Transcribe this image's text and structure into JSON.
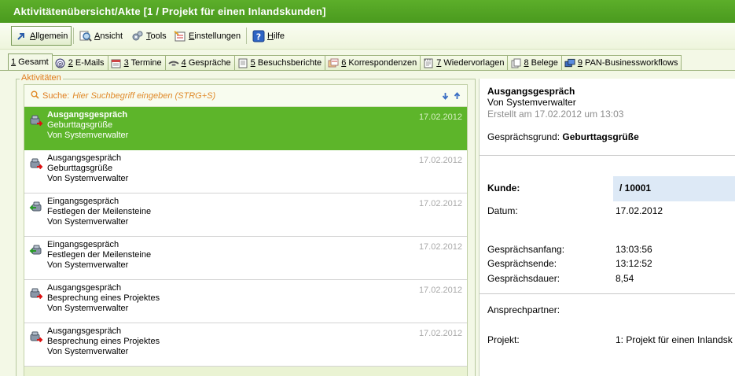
{
  "window": {
    "title": "Aktivitätenübersicht/Akte [1 / Projekt für einen Inlandskunden]"
  },
  "toolbar": {
    "allgemein": {
      "pre": "",
      "u": "A",
      "post": "llgemein"
    },
    "ansicht": {
      "pre": "",
      "u": "A",
      "post": "nsicht"
    },
    "tools": {
      "pre": "",
      "u": "T",
      "post": "ools"
    },
    "einstellungen": {
      "pre": "",
      "u": "E",
      "post": "instellungen"
    },
    "hilfe": {
      "pre": "",
      "u": "H",
      "post": "ilfe"
    }
  },
  "tabs": [
    {
      "num": "1",
      "label": " Gesamt",
      "icon": ""
    },
    {
      "num": "2",
      "label": " E-Mails",
      "icon": "at-icon"
    },
    {
      "num": "3",
      "label": " Termine",
      "icon": "calendar-icon"
    },
    {
      "num": "4",
      "label": " Gespräche",
      "icon": "phone-icon"
    },
    {
      "num": "5",
      "label": " Besuchsberichte",
      "icon": "report-icon"
    },
    {
      "num": "6",
      "label": " Korrespondenzen",
      "icon": "letters-icon"
    },
    {
      "num": "7",
      "label": " Wiedervorlagen",
      "icon": "notepad-icon"
    },
    {
      "num": "8",
      "label": " Belege",
      "icon": "documents-icon"
    },
    {
      "num": "9",
      "label": " PAN-Businessworkflows",
      "icon": "workflow-icon"
    }
  ],
  "group": {
    "legend": "Aktivitäten"
  },
  "search": {
    "label": "Suche:",
    "placeholder": "Hier Suchbegriff eingeben (STRG+S)"
  },
  "activities": [
    {
      "type": "Ausgangsgespräch",
      "subject": "Geburttagsgrüße",
      "author": "Von Systemverwalter",
      "date": "17.02.2012",
      "direction": "outgoing"
    },
    {
      "type": "Ausgangsgespräch",
      "subject": "Geburttagsgrüße",
      "author": "Von Systemverwalter",
      "date": "17.02.2012",
      "direction": "outgoing"
    },
    {
      "type": "Eingangsgespräch",
      "subject": "Festlegen der Meilensteine",
      "author": "Von Systemverwalter",
      "date": "17.02.2012",
      "direction": "incoming"
    },
    {
      "type": "Eingangsgespräch",
      "subject": "Festlegen der Meilensteine",
      "author": "Von Systemverwalter",
      "date": "17.02.2012",
      "direction": "incoming"
    },
    {
      "type": "Ausgangsgespräch",
      "subject": "Besprechung eines Projektes",
      "author": "Von Systemverwalter",
      "date": "17.02.2012",
      "direction": "outgoing"
    },
    {
      "type": "Ausgangsgespräch",
      "subject": "Besprechung eines Projektes",
      "author": "Von Systemverwalter",
      "date": "17.02.2012",
      "direction": "outgoing"
    }
  ],
  "detail": {
    "title": "Ausgangsgespräch",
    "by": "Von Systemverwalter",
    "created": "Erstellt am 17.02.2012 um 13:03",
    "reason_label": "Gesprächsgrund:",
    "reason_value": "Geburttagsgrüße",
    "kunde_label": "Kunde:",
    "kunde_value": "/ 10001",
    "datum_label": "Datum:",
    "datum_value": "17.02.2012",
    "anfang_label": "Gesprächsanfang:",
    "anfang_value": "13:03:56",
    "ende_label": "Gesprächsende:",
    "ende_value": "13:12:52",
    "dauer_label": "Gesprächsdauer:",
    "dauer_value": "8,54",
    "partner_label": "Ansprechpartner:",
    "projekt_label": "Projekt:",
    "projekt_value": "1: Projekt für einen Inlandsk"
  },
  "colors": {
    "accent_green": "#5db52a",
    "orange_label": "#e07b1b",
    "kunde_highlight": "#dde9f6"
  }
}
